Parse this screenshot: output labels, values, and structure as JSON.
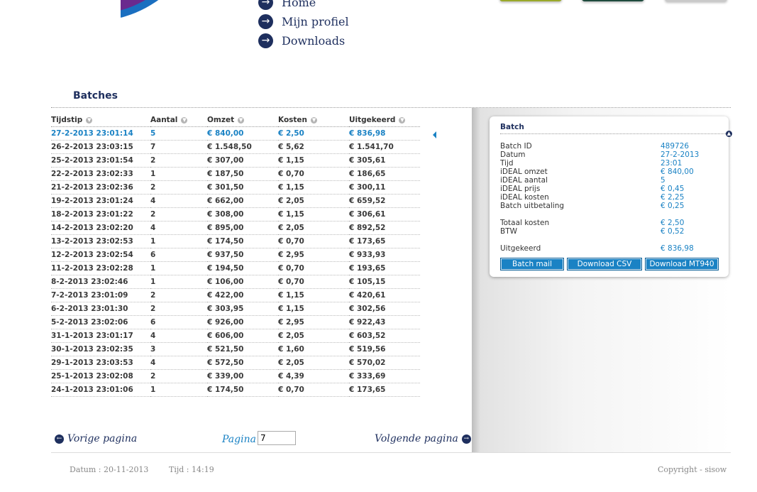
{
  "nav": {
    "items": [
      {
        "label": "Home"
      },
      {
        "label": "Mijn profiel"
      },
      {
        "label": "Downloads"
      }
    ]
  },
  "colors": {
    "accent": "#1a82c4",
    "navy": "#1e2f5e"
  },
  "section": {
    "title": "Batches"
  },
  "table": {
    "headers": [
      "Tijdstip",
      "Aantal",
      "Omzet",
      "Kosten",
      "Uitgekeerd"
    ],
    "selected_index": 0,
    "rows": [
      [
        "27-2-2013 23:01:14",
        "5",
        "€ 840,00",
        "€ 2,50",
        "€ 836,98"
      ],
      [
        "26-2-2013 23:03:15",
        "7",
        "€ 1.548,50",
        "€ 5,62",
        "€ 1.541,70"
      ],
      [
        "25-2-2013 23:01:54",
        "2",
        "€ 307,00",
        "€ 1,15",
        "€ 305,61"
      ],
      [
        "22-2-2013 23:02:33",
        "1",
        "€ 187,50",
        "€ 0,70",
        "€ 186,65"
      ],
      [
        "21-2-2013 23:02:36",
        "2",
        "€ 301,50",
        "€ 1,15",
        "€ 300,11"
      ],
      [
        "19-2-2013 23:01:24",
        "4",
        "€ 662,00",
        "€ 2,05",
        "€ 659,52"
      ],
      [
        "18-2-2013 23:01:22",
        "2",
        "€ 308,00",
        "€ 1,15",
        "€ 306,61"
      ],
      [
        "14-2-2013 23:02:20",
        "4",
        "€ 895,00",
        "€ 2,05",
        "€ 892,52"
      ],
      [
        "13-2-2013 23:02:53",
        "1",
        "€ 174,50",
        "€ 0,70",
        "€ 173,65"
      ],
      [
        "12-2-2013 23:02:54",
        "6",
        "€ 937,50",
        "€ 2,95",
        "€ 933,93"
      ],
      [
        "11-2-2013 23:02:28",
        "1",
        "€ 194,50",
        "€ 0,70",
        "€ 193,65"
      ],
      [
        "8-2-2013 23:02:46",
        "1",
        "€ 106,00",
        "€ 0,70",
        "€ 105,15"
      ],
      [
        "7-2-2013 23:01:09",
        "2",
        "€ 422,00",
        "€ 1,15",
        "€ 420,61"
      ],
      [
        "6-2-2013 23:01:30",
        "2",
        "€ 303,95",
        "€ 1,15",
        "€ 302,56"
      ],
      [
        "5-2-2013 23:02:06",
        "6",
        "€ 926,00",
        "€ 2,95",
        "€ 922,43"
      ],
      [
        "31-1-2013 23:01:17",
        "4",
        "€ 606,00",
        "€ 2,05",
        "€ 603,52"
      ],
      [
        "30-1-2013 23:02:35",
        "3",
        "€ 521,50",
        "€ 1,60",
        "€ 519,56"
      ],
      [
        "29-1-2013 23:03:53",
        "4",
        "€ 572,50",
        "€ 2,05",
        "€ 570,02"
      ],
      [
        "25-1-2013 23:02:08",
        "2",
        "€ 339,00",
        "€ 4,39",
        "€ 333,69"
      ],
      [
        "24-1-2013 23:01:06",
        "1",
        "€ 174,50",
        "€ 0,70",
        "€ 173,65"
      ]
    ]
  },
  "detail": {
    "title": "Batch",
    "fields": [
      {
        "label": "Batch ID",
        "value": "489726"
      },
      {
        "label": "Datum",
        "value": "27-2-2013"
      },
      {
        "label": "Tijd",
        "value": "23:01"
      },
      {
        "label": "iDEAL omzet",
        "value": "€ 840,00"
      },
      {
        "label": "iDEAL aantal",
        "value": "5"
      },
      {
        "label": "iDEAL prijs",
        "value": "€ 0,45"
      },
      {
        "label": "iDEAL kosten",
        "value": "€ 2,25"
      },
      {
        "label": "Batch uitbetaling",
        "value": "€ 0,25"
      },
      {
        "label": "Totaal kosten",
        "value": "€ 2,50"
      },
      {
        "label": "BTW",
        "value": "€ 0,52"
      },
      {
        "label": "Uitgekeerd",
        "value": "€ 836,98"
      }
    ],
    "buttons": {
      "mail": "Batch mail",
      "csv": "Download CSV",
      "mt940": "Download MT940"
    }
  },
  "pagination": {
    "prev": "Vorige pagina",
    "next": "Volgende pagina",
    "page_label": "Pagina",
    "page_value": "7"
  },
  "footer": {
    "date": "Datum : 20-11-2013",
    "time": "Tijd : 14:19",
    "copyright": "Copyright - sisow"
  }
}
